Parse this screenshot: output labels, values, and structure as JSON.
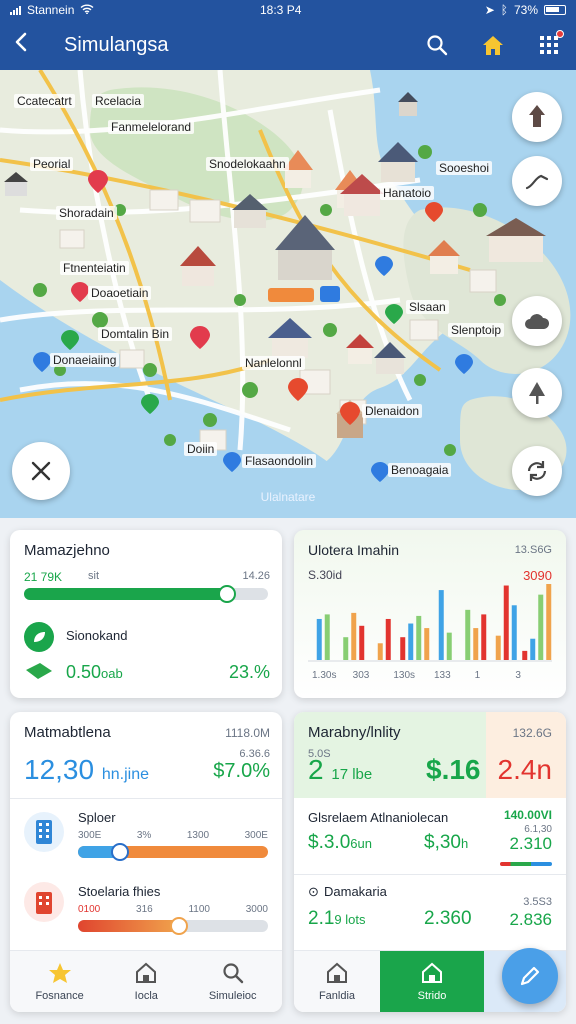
{
  "status": {
    "carrier": "Stannein",
    "time": "18:3 P4",
    "battery": "73%"
  },
  "header": {
    "title": "Simulangsa"
  },
  "map": {
    "labels": [
      "Ccatecatrt",
      "Rcelacia",
      "Fanmelelorand",
      "Peorial",
      "Snodelokaahn",
      "Sooeshoi",
      "Hanatoio",
      "Shoradain",
      "Doaoetiain",
      "Slsaan",
      "Slenptoip",
      "Domtalin Bin",
      "Donaeiaiing",
      "Nanlelonnl",
      "Dlenaidon",
      "Flasaondolin",
      "Benoagaia",
      "Doiin",
      "Ftnenteiatin"
    ],
    "bottom_label": "Ulalnatare"
  },
  "card1": {
    "title": "Mamazjehno",
    "left_value": "21 79K",
    "mid_value": "sit",
    "right_value": "14.26",
    "progress": 0.83,
    "item_label": "Sionokand",
    "big_value": "0.50",
    "big_unit": "oab",
    "percent": "23.%"
  },
  "card2": {
    "title": "Ulotera Imahin",
    "top_right": "13.S6G",
    "left_value": "S.30id",
    "right_value": "3090",
    "bars": [
      [
        0.54,
        0.6
      ],
      [
        0.3,
        0.62,
        0.45
      ],
      [
        0.22,
        0.54
      ],
      [
        0.3,
        0.48,
        0.58,
        0.42
      ],
      [
        0.92,
        0.36
      ],
      [
        0.66,
        0.42,
        0.6
      ],
      [
        0.32,
        0.98,
        0.72
      ],
      [
        0.12,
        0.28,
        0.86,
        1.0
      ]
    ],
    "bar_colors": [
      "#3fa3e6",
      "#88ce73",
      "#f0a34c",
      "#e2342f"
    ],
    "x_labels": [
      "1.30s",
      "303",
      "130s",
      "133",
      "1",
      "3"
    ]
  },
  "card3": {
    "title": "Matmabtlena",
    "top_right": "1118.0M",
    "sub_right": "6.36.6",
    "big_value": "12,30",
    "big_unit": "hn.jine",
    "right_value": "$7.0%",
    "item1_label": "Sploer",
    "item1_ticks": [
      "300E",
      "3%",
      "1300",
      "300E"
    ],
    "item1_progress": 0.22,
    "item2_label": "Stoelaria fhies",
    "item2_ticks": [
      "0100",
      "316",
      "1100",
      "3000"
    ],
    "item2_progress": 0.53
  },
  "card4": {
    "title": "Marabny/lnlity",
    "top_right": "132.6G",
    "sub_left": "5.0S",
    "big_value": "2",
    "big_unit": "17 lbe",
    "price": "$.16",
    "red_value": "2.4n",
    "row1_label": "Glsrelaem Atlnaniolecan",
    "row1_top": "140.00VI",
    "row1_sub": "6.1,30",
    "row1_val1": "$.3.0",
    "row1_val1_unit": "6un",
    "row1_val2": "$,30",
    "row1_val2_unit": "h",
    "row1_val3": "2.310",
    "row2_label": "Damakaria",
    "row2_top": "3.5S3",
    "row2_val1": "2.1",
    "row2_val1_unit": "9 lots",
    "row2_val2": "2.360",
    "row2_val3": "2.836"
  },
  "nav_left": [
    {
      "label": "Fosnance"
    },
    {
      "label": "Iocla"
    },
    {
      "label": "Simuleioc"
    }
  ],
  "nav_right": [
    {
      "label": "Fanldia"
    },
    {
      "label": "Strido"
    }
  ]
}
